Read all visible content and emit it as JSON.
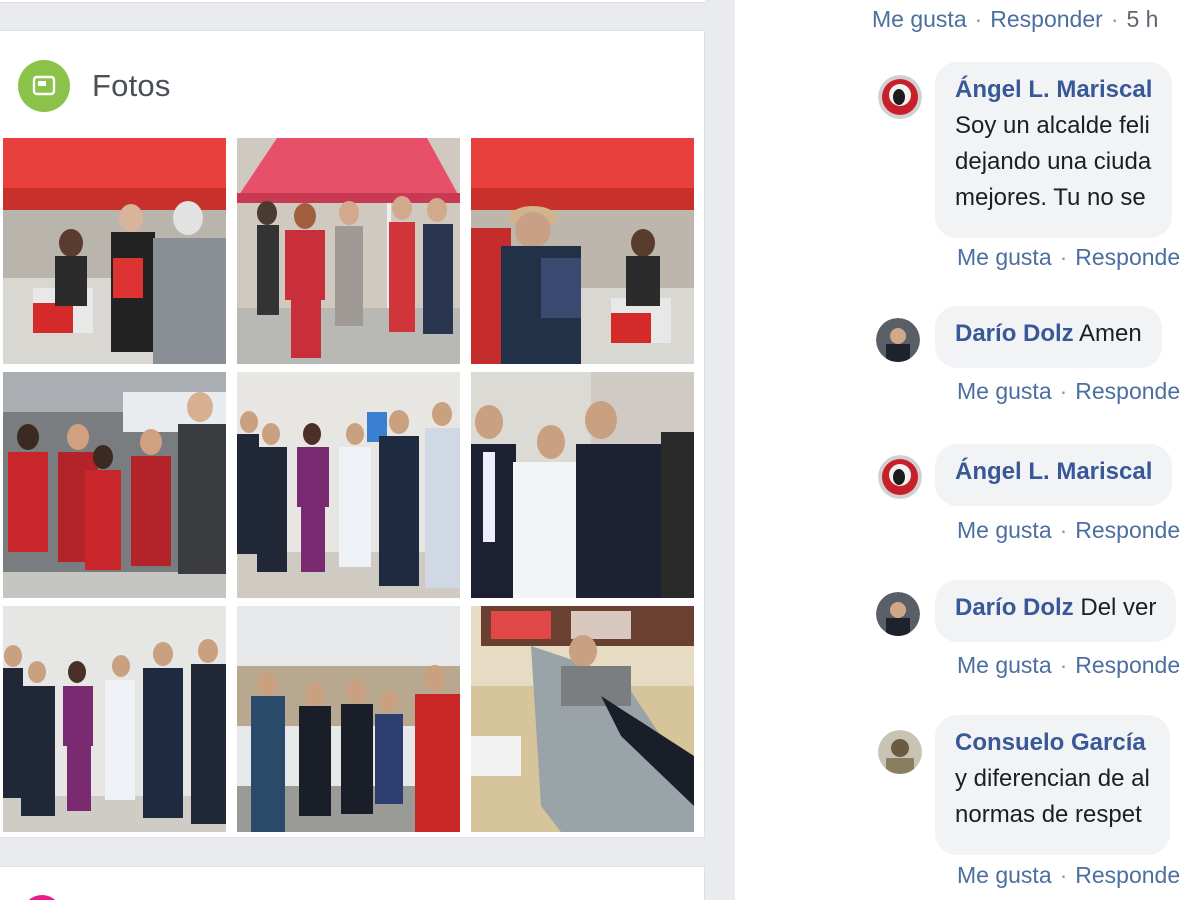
{
  "photos": {
    "title": "Fotos",
    "icon": "photos-icon",
    "accent": "#8bc34a",
    "items": [
      {
        "name": "photo-red-tent-booth"
      },
      {
        "name": "photo-red-tent-crowd"
      },
      {
        "name": "photo-red-tent-man-hat"
      },
      {
        "name": "photo-group-red-vests"
      },
      {
        "name": "photo-group-suits"
      },
      {
        "name": "photo-three-men"
      },
      {
        "name": "photo-group-indoor"
      },
      {
        "name": "photo-group-outdoor"
      },
      {
        "name": "photo-blood-donation"
      }
    ]
  },
  "top_actions": {
    "like": "Me gusta",
    "reply": "Responder",
    "time": "5 h"
  },
  "comments": [
    {
      "author": "Ángel L. Mariscal",
      "lines": [
        "Soy un alcalde feli",
        "dejando una ciuda",
        "mejores. Tu no se"
      ],
      "like": "Me gusta",
      "reply": "Responde"
    },
    {
      "author": "Darío Dolz",
      "text": "Amen",
      "like": "Me gusta",
      "reply": "Responde"
    },
    {
      "author": "Ángel L. Mariscal",
      "like": "Me gusta",
      "reply": "Responde"
    },
    {
      "author": "Darío Dolz",
      "text": "Del ver",
      "like": "Me gusta",
      "reply": "Responde"
    },
    {
      "author": "Consuelo García",
      "lines": [
        "y diferencian de al",
        "normas de respet"
      ],
      "like": "Me gusta",
      "reply": "Responde"
    }
  ],
  "colors": {
    "link": "#385898",
    "action_link": "#4b6fa0",
    "bubble": "#f2f3f5",
    "page_bg": "#e9ebee"
  }
}
